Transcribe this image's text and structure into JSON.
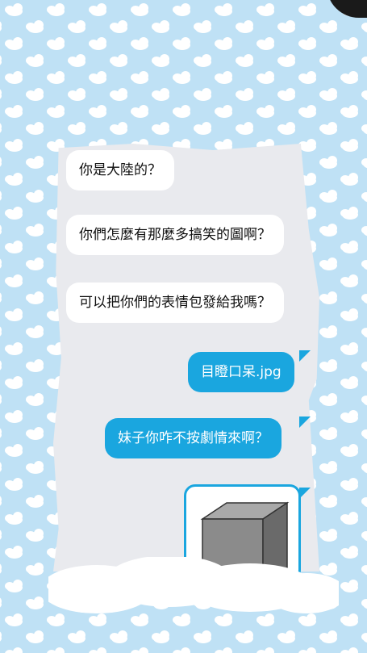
{
  "chat": {
    "messages": [
      {
        "side": "left",
        "text": "你是大陸的？"
      },
      {
        "side": "left",
        "text": "你們怎麼有那麼多搞笑的圖啊？"
      },
      {
        "side": "left",
        "text": "可以把你們的表情包發給我嗎？"
      },
      {
        "side": "right",
        "text": "目瞪口呆.jpg"
      },
      {
        "side": "right",
        "text": "妹子你咋不按劇情來啊？"
      }
    ]
  },
  "colors": {
    "background": "#bfe1f5",
    "paper": "#e9eaee",
    "sent_bubble": "#1aa6df",
    "received_bubble": "#ffffff"
  },
  "icons": {
    "cube": "gray-cube-image"
  }
}
